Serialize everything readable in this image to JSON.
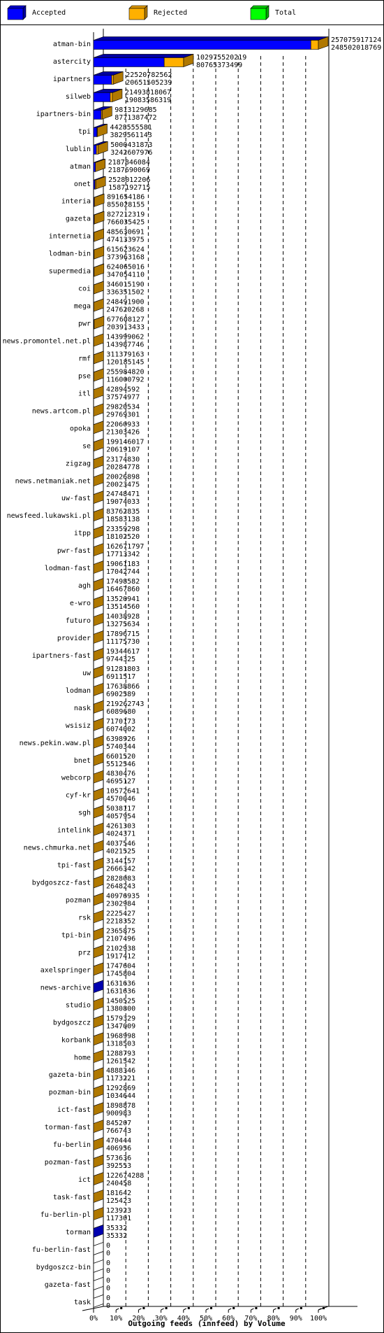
{
  "legend": [
    {
      "label": "Accepted",
      "color": "#0000ff",
      "side": "#00009f"
    },
    {
      "label": "Rejected",
      "color": "#ffb000",
      "side": "#b07800"
    },
    {
      "label": "Total",
      "color": "#00ff00",
      "side": "#00a800"
    }
  ],
  "chart_data": {
    "type": "bar",
    "orientation": "horizontal",
    "stacked": true,
    "title": "",
    "xlabel": "Outgoing feeds (innfeed) by Volume",
    "ylabel": "",
    "xlim": [
      0,
      100
    ],
    "x_unit": "%",
    "x_ticks": [
      "0%",
      "10%",
      "20%",
      "30%",
      "40%",
      "50%",
      "60%",
      "70%",
      "80%",
      "90%",
      "100%"
    ],
    "grid": true,
    "legend_position": "top",
    "series_names": [
      "Accepted",
      "Rejected"
    ],
    "colors": {
      "accepted": "#0000ff",
      "rejected": "#ffb000",
      "top_accepted": "#0000a0",
      "side": "#b07800"
    },
    "rows": [
      {
        "name": "atman-bin",
        "total": 257075917124,
        "accepted": 248502018769
      },
      {
        "name": "astercity",
        "total": 102975520219,
        "accepted": 80765373499
      },
      {
        "name": "ipartners",
        "total": 22520782562,
        "accepted": 20651505239
      },
      {
        "name": "silweb",
        "total": 21493818067,
        "accepted": 19083586319
      },
      {
        "name": "ipartners-bin",
        "total": 9813129685,
        "accepted": 8771387472
      },
      {
        "name": "tpi",
        "total": 4428555581,
        "accepted": 3829561143
      },
      {
        "name": "lublin",
        "total": 5000431873,
        "accepted": 3242607976
      },
      {
        "name": "atman",
        "total": 2187846084,
        "accepted": 2187690069
      },
      {
        "name": "onet",
        "total": 2528012206,
        "accepted": 1587192715
      },
      {
        "name": "interia",
        "total": 891654186,
        "accepted": 855028155
      },
      {
        "name": "gazeta",
        "total": 827212319,
        "accepted": 766035425
      },
      {
        "name": "internetia",
        "total": 485630691,
        "accepted": 474133975
      },
      {
        "name": "lodman-bin",
        "total": 615623624,
        "accepted": 373963168
      },
      {
        "name": "supermedia",
        "total": 624065016,
        "accepted": 347054110
      },
      {
        "name": "coi",
        "total": 346015190,
        "accepted": 336351502
      },
      {
        "name": "mega",
        "total": 248491900,
        "accepted": 247620268
      },
      {
        "name": "pwr",
        "total": 677608127,
        "accepted": 203913433
      },
      {
        "name": "news.promontel.net.pl",
        "total": 143999062,
        "accepted": 143987746
      },
      {
        "name": "rmf",
        "total": 311379163,
        "accepted": 120185145
      },
      {
        "name": "pse",
        "total": 255984820,
        "accepted": 116000792
      },
      {
        "name": "itl",
        "total": 42894592,
        "accepted": 37574977
      },
      {
        "name": "news.artcom.pl",
        "total": 29820534,
        "accepted": 29769301
      },
      {
        "name": "opoka",
        "total": 22060933,
        "accepted": 21303426
      },
      {
        "name": "se",
        "total": 199146017,
        "accepted": 20619107
      },
      {
        "name": "zigzag",
        "total": 23174830,
        "accepted": 20284778
      },
      {
        "name": "news.netmaniak.net",
        "total": 20026898,
        "accepted": 20023475
      },
      {
        "name": "uw-fast",
        "total": 24748471,
        "accepted": 19074033
      },
      {
        "name": "newsfeed.lukawski.pl",
        "total": 83762835,
        "accepted": 18583138
      },
      {
        "name": "itpp",
        "total": 23359298,
        "accepted": 18102520
      },
      {
        "name": "pwr-fast",
        "total": 162671797,
        "accepted": 17713342
      },
      {
        "name": "lodman-fast",
        "total": 19061183,
        "accepted": 17042744
      },
      {
        "name": "agh",
        "total": 17498582,
        "accepted": 16467860
      },
      {
        "name": "e-wro",
        "total": 13520941,
        "accepted": 13514560
      },
      {
        "name": "futuro",
        "total": 14038928,
        "accepted": 13275634
      },
      {
        "name": "provider",
        "total": 17896715,
        "accepted": 11175730
      },
      {
        "name": "ipartners-fast",
        "total": 19344617,
        "accepted": 9744325
      },
      {
        "name": "uw",
        "total": 91281803,
        "accepted": 6911517
      },
      {
        "name": "lodman",
        "total": 17638866,
        "accepted": 6902589
      },
      {
        "name": "nask",
        "total": 219262743,
        "accepted": 6089680
      },
      {
        "name": "wsisiz",
        "total": 7170173,
        "accepted": 6074002
      },
      {
        "name": "news.pekin.waw.pl",
        "total": 6398926,
        "accepted": 5740344
      },
      {
        "name": "bnet",
        "total": 6601520,
        "accepted": 5512546
      },
      {
        "name": "webcorp",
        "total": 4830476,
        "accepted": 4695127
      },
      {
        "name": "cyf-kr",
        "total": 10572641,
        "accepted": 4570046
      },
      {
        "name": "sgh",
        "total": 5038117,
        "accepted": 4057954
      },
      {
        "name": "intelink",
        "total": 4261303,
        "accepted": 4024371
      },
      {
        "name": "news.chmurka.net",
        "total": 4037546,
        "accepted": 4021525
      },
      {
        "name": "tpi-fast",
        "total": 3144157,
        "accepted": 2666342
      },
      {
        "name": "bydgoszcz-fast",
        "total": 2828083,
        "accepted": 2648243
      },
      {
        "name": "pozman",
        "total": 40976935,
        "accepted": 2302984
      },
      {
        "name": "rsk",
        "total": 2225427,
        "accepted": 2218352
      },
      {
        "name": "tpi-bin",
        "total": 2365875,
        "accepted": 2107496
      },
      {
        "name": "prz",
        "total": 2102938,
        "accepted": 1917412
      },
      {
        "name": "axelspringer",
        "total": 1747604,
        "accepted": 1745804
      },
      {
        "name": "news-archive",
        "total": 1631636,
        "accepted": 1631636
      },
      {
        "name": "studio",
        "total": 1450525,
        "accepted": 1380800
      },
      {
        "name": "bydgoszcz",
        "total": 1579329,
        "accepted": 1347009
      },
      {
        "name": "korbank",
        "total": 1968998,
        "accepted": 1318503
      },
      {
        "name": "home",
        "total": 1288793,
        "accepted": 1261542
      },
      {
        "name": "gazeta-bin",
        "total": 4888346,
        "accepted": 1173221
      },
      {
        "name": "pozman-bin",
        "total": 1292869,
        "accepted": 1034644
      },
      {
        "name": "ict-fast",
        "total": 1898878,
        "accepted": 900983
      },
      {
        "name": "torman-fast",
        "total": 845207,
        "accepted": 766743
      },
      {
        "name": "fu-berlin",
        "total": 470444,
        "accepted": 406956
      },
      {
        "name": "pozman-fast",
        "total": 573636,
        "accepted": 392553
      },
      {
        "name": "ict",
        "total": 122674288,
        "accepted": 240458
      },
      {
        "name": "task-fast",
        "total": 181642,
        "accepted": 125423
      },
      {
        "name": "fu-berlin-pl",
        "total": 123923,
        "accepted": 117301
      },
      {
        "name": "torman",
        "total": 35332,
        "accepted": 35332
      },
      {
        "name": "fu-berlin-fast",
        "total": 0,
        "accepted": 0
      },
      {
        "name": "bydgoszcz-bin",
        "total": 0,
        "accepted": 0
      },
      {
        "name": "gazeta-fast",
        "total": 0,
        "accepted": 0
      },
      {
        "name": "task",
        "total": 0,
        "accepted": 0
      }
    ]
  }
}
